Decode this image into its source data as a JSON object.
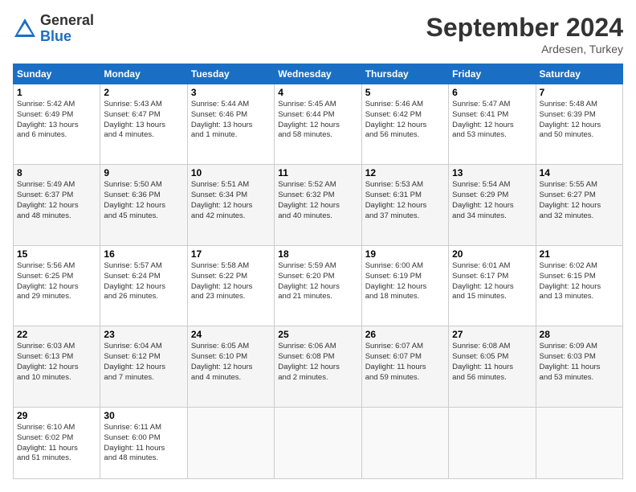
{
  "header": {
    "logo_general": "General",
    "logo_blue": "Blue",
    "month_title": "September 2024",
    "location": "Ardesen, Turkey"
  },
  "days_of_week": [
    "Sunday",
    "Monday",
    "Tuesday",
    "Wednesday",
    "Thursday",
    "Friday",
    "Saturday"
  ],
  "weeks": [
    [
      {
        "day": "1",
        "info": "Sunrise: 5:42 AM\nSunset: 6:49 PM\nDaylight: 13 hours\nand 6 minutes."
      },
      {
        "day": "2",
        "info": "Sunrise: 5:43 AM\nSunset: 6:47 PM\nDaylight: 13 hours\nand 4 minutes."
      },
      {
        "day": "3",
        "info": "Sunrise: 5:44 AM\nSunset: 6:46 PM\nDaylight: 13 hours\nand 1 minute."
      },
      {
        "day": "4",
        "info": "Sunrise: 5:45 AM\nSunset: 6:44 PM\nDaylight: 12 hours\nand 58 minutes."
      },
      {
        "day": "5",
        "info": "Sunrise: 5:46 AM\nSunset: 6:42 PM\nDaylight: 12 hours\nand 56 minutes."
      },
      {
        "day": "6",
        "info": "Sunrise: 5:47 AM\nSunset: 6:41 PM\nDaylight: 12 hours\nand 53 minutes."
      },
      {
        "day": "7",
        "info": "Sunrise: 5:48 AM\nSunset: 6:39 PM\nDaylight: 12 hours\nand 50 minutes."
      }
    ],
    [
      {
        "day": "8",
        "info": "Sunrise: 5:49 AM\nSunset: 6:37 PM\nDaylight: 12 hours\nand 48 minutes."
      },
      {
        "day": "9",
        "info": "Sunrise: 5:50 AM\nSunset: 6:36 PM\nDaylight: 12 hours\nand 45 minutes."
      },
      {
        "day": "10",
        "info": "Sunrise: 5:51 AM\nSunset: 6:34 PM\nDaylight: 12 hours\nand 42 minutes."
      },
      {
        "day": "11",
        "info": "Sunrise: 5:52 AM\nSunset: 6:32 PM\nDaylight: 12 hours\nand 40 minutes."
      },
      {
        "day": "12",
        "info": "Sunrise: 5:53 AM\nSunset: 6:31 PM\nDaylight: 12 hours\nand 37 minutes."
      },
      {
        "day": "13",
        "info": "Sunrise: 5:54 AM\nSunset: 6:29 PM\nDaylight: 12 hours\nand 34 minutes."
      },
      {
        "day": "14",
        "info": "Sunrise: 5:55 AM\nSunset: 6:27 PM\nDaylight: 12 hours\nand 32 minutes."
      }
    ],
    [
      {
        "day": "15",
        "info": "Sunrise: 5:56 AM\nSunset: 6:25 PM\nDaylight: 12 hours\nand 29 minutes."
      },
      {
        "day": "16",
        "info": "Sunrise: 5:57 AM\nSunset: 6:24 PM\nDaylight: 12 hours\nand 26 minutes."
      },
      {
        "day": "17",
        "info": "Sunrise: 5:58 AM\nSunset: 6:22 PM\nDaylight: 12 hours\nand 23 minutes."
      },
      {
        "day": "18",
        "info": "Sunrise: 5:59 AM\nSunset: 6:20 PM\nDaylight: 12 hours\nand 21 minutes."
      },
      {
        "day": "19",
        "info": "Sunrise: 6:00 AM\nSunset: 6:19 PM\nDaylight: 12 hours\nand 18 minutes."
      },
      {
        "day": "20",
        "info": "Sunrise: 6:01 AM\nSunset: 6:17 PM\nDaylight: 12 hours\nand 15 minutes."
      },
      {
        "day": "21",
        "info": "Sunrise: 6:02 AM\nSunset: 6:15 PM\nDaylight: 12 hours\nand 13 minutes."
      }
    ],
    [
      {
        "day": "22",
        "info": "Sunrise: 6:03 AM\nSunset: 6:13 PM\nDaylight: 12 hours\nand 10 minutes."
      },
      {
        "day": "23",
        "info": "Sunrise: 6:04 AM\nSunset: 6:12 PM\nDaylight: 12 hours\nand 7 minutes."
      },
      {
        "day": "24",
        "info": "Sunrise: 6:05 AM\nSunset: 6:10 PM\nDaylight: 12 hours\nand 4 minutes."
      },
      {
        "day": "25",
        "info": "Sunrise: 6:06 AM\nSunset: 6:08 PM\nDaylight: 12 hours\nand 2 minutes."
      },
      {
        "day": "26",
        "info": "Sunrise: 6:07 AM\nSunset: 6:07 PM\nDaylight: 11 hours\nand 59 minutes."
      },
      {
        "day": "27",
        "info": "Sunrise: 6:08 AM\nSunset: 6:05 PM\nDaylight: 11 hours\nand 56 minutes."
      },
      {
        "day": "28",
        "info": "Sunrise: 6:09 AM\nSunset: 6:03 PM\nDaylight: 11 hours\nand 53 minutes."
      }
    ],
    [
      {
        "day": "29",
        "info": "Sunrise: 6:10 AM\nSunset: 6:02 PM\nDaylight: 11 hours\nand 51 minutes."
      },
      {
        "day": "30",
        "info": "Sunrise: 6:11 AM\nSunset: 6:00 PM\nDaylight: 11 hours\nand 48 minutes."
      },
      {
        "day": "",
        "info": ""
      },
      {
        "day": "",
        "info": ""
      },
      {
        "day": "",
        "info": ""
      },
      {
        "day": "",
        "info": ""
      },
      {
        "day": "",
        "info": ""
      }
    ]
  ]
}
